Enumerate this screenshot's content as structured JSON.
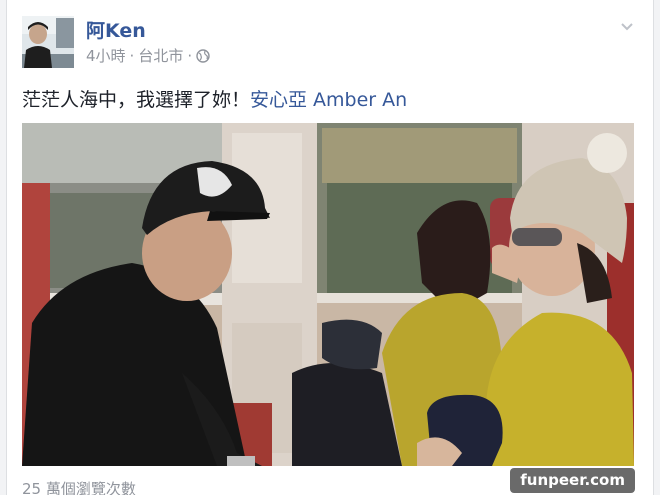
{
  "post": {
    "author": "阿Ken",
    "time": "4小時",
    "location": "台北市",
    "separator": "·",
    "text": "茫茫人海中，我選擇了妳！",
    "tag": "安心亞 Amber An",
    "views": "25 萬個瀏覽次數"
  },
  "watermark": "funpeer.com",
  "icons": {
    "privacy": "globe-icon",
    "options": "chevron-down-icon"
  },
  "colors": {
    "link": "#365899",
    "meta": "#90949c",
    "text": "#1d2129"
  }
}
